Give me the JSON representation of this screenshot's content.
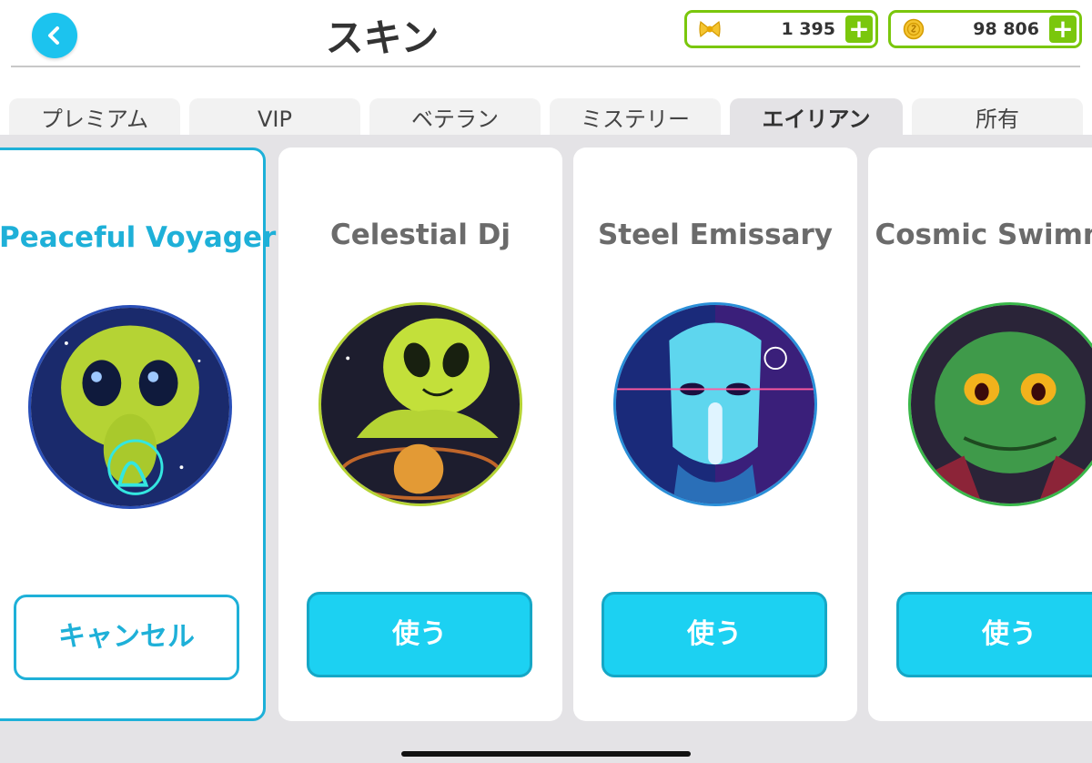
{
  "header": {
    "title": "スキン",
    "currency": [
      {
        "icon": "gold-bow-icon",
        "value": "1 395"
      },
      {
        "icon": "gold-coin-icon",
        "value": "98 806"
      }
    ],
    "plus_label": "+"
  },
  "tabs": [
    {
      "label": "プレミアム",
      "active": false
    },
    {
      "label": "VIP",
      "active": false
    },
    {
      "label": "ベテラン",
      "active": false
    },
    {
      "label": "ミステリー",
      "active": false
    },
    {
      "label": "エイリアン",
      "active": true
    },
    {
      "label": "所有",
      "active": false
    }
  ],
  "skins": [
    {
      "name": "Peaceful Voyager",
      "button": "キャンセル",
      "selected": true
    },
    {
      "name": "Celestial Dj",
      "button": "使う",
      "selected": false
    },
    {
      "name": "Steel Emissary",
      "button": "使う",
      "selected": false
    },
    {
      "name": "Cosmic Swimmer",
      "button": "使う",
      "selected": false
    }
  ],
  "colors": {
    "accent": "#1cc3ee",
    "selected_border": "#1eb0d8",
    "currency_border": "#7ac70c"
  }
}
